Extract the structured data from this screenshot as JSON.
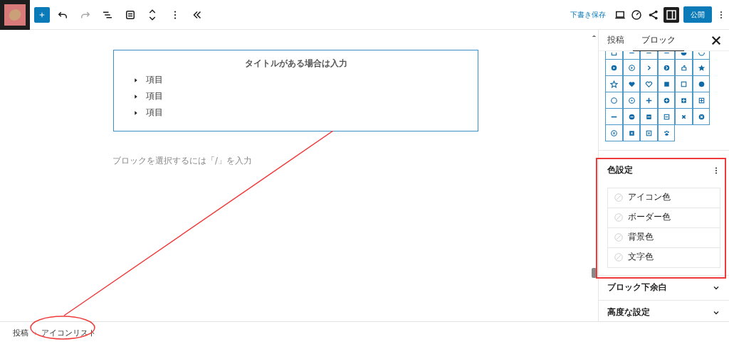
{
  "toolbar": {
    "save_draft": "下書き保存",
    "publish": "公開",
    "settings_open": true
  },
  "editor": {
    "block": {
      "title": "タイトルがある場合は入力",
      "items": [
        "項目",
        "項目",
        "項目"
      ]
    },
    "placeholder": "ブロックを選択するには「/」を入力"
  },
  "sidebar": {
    "tabs": [
      {
        "label": "投稿",
        "selected": false
      },
      {
        "label": "ブロック",
        "selected": true
      }
    ],
    "panels": [
      {
        "kind": "colors",
        "title": "色設定",
        "options": [
          "アイコン色",
          "ボーダー色",
          "背景色",
          "文字色"
        ]
      },
      {
        "kind": "collapsed",
        "title": "ブロック下余白"
      },
      {
        "kind": "collapsed",
        "title": "高度な設定"
      }
    ]
  },
  "breadcrumb": [
    "投稿",
    "アイコンリスト"
  ]
}
